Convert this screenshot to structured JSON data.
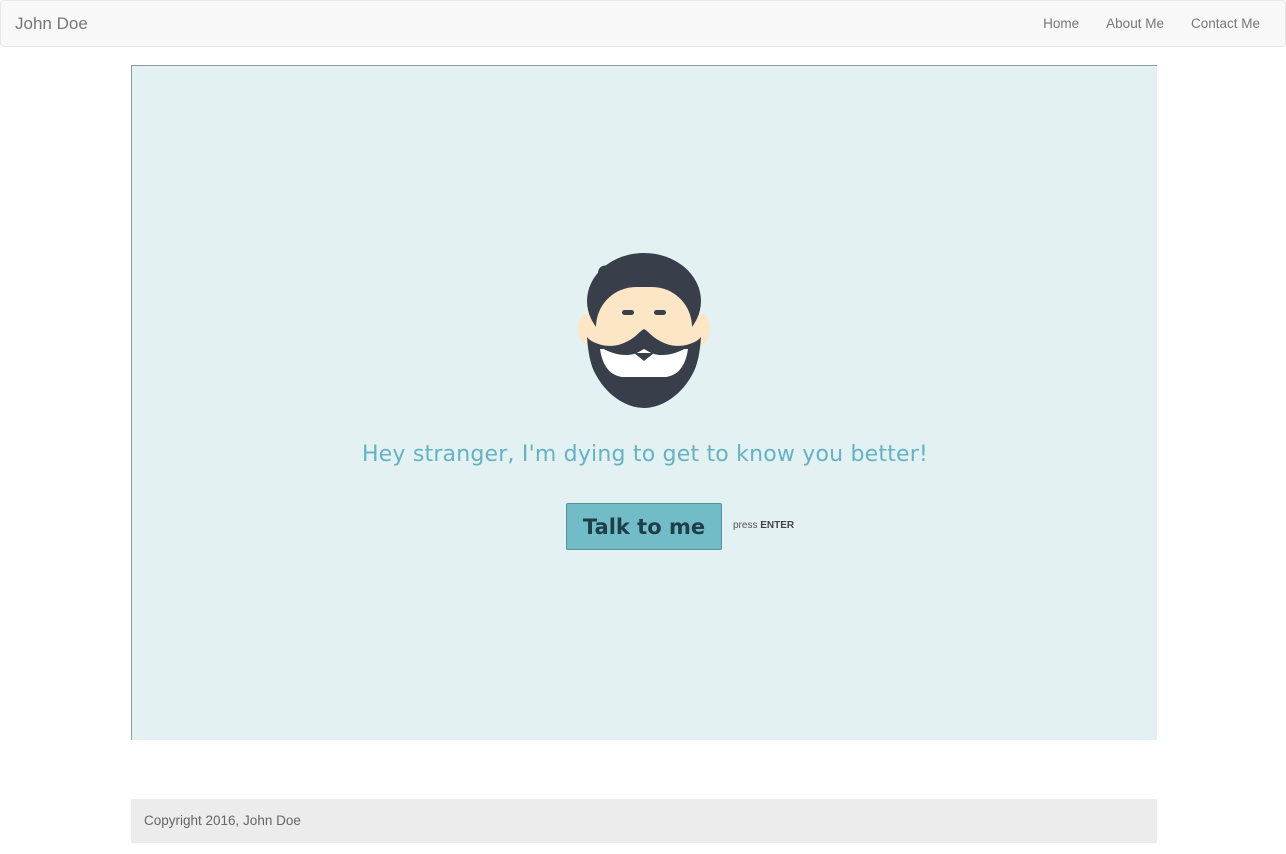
{
  "navbar": {
    "brand": "John Doe",
    "links": [
      "Home",
      "About Me",
      "Contact Me"
    ]
  },
  "hero": {
    "avatar_icon": "bearded-man-avatar-icon",
    "tagline": "Hey stranger, I'm dying to get to know you better!",
    "button_label": "Talk to me",
    "hint_prefix": "press",
    "hint_key": "ENTER"
  },
  "footer": {
    "copyright": "Copyright 2016, John Doe"
  },
  "colors": {
    "stage_bg": "#e3f1f3",
    "accent": "#63b3c2",
    "button_bg": "#72bcc8",
    "hair": "#383f4a",
    "skin": "#fce6c6"
  }
}
